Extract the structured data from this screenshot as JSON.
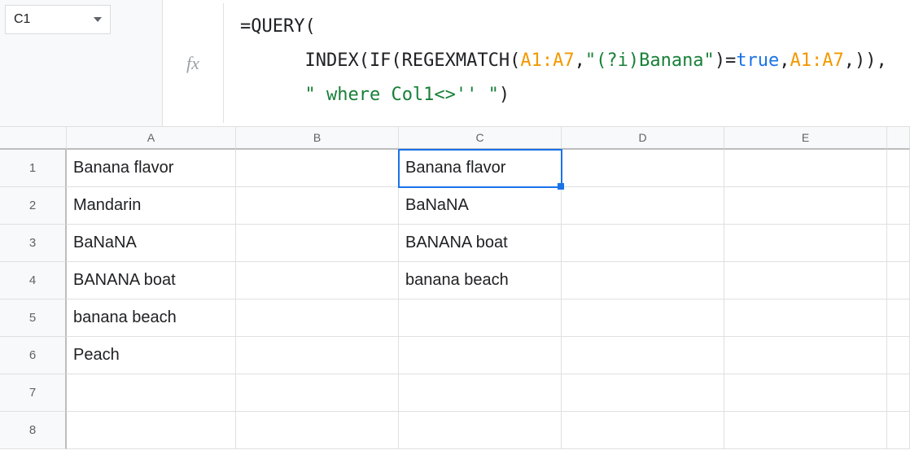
{
  "nameBox": {
    "value": "C1"
  },
  "fx": {
    "label": "fx"
  },
  "formula": {
    "tokens": [
      [
        {
          "t": "=QUERY(",
          "c": "tok-func"
        }
      ],
      [
        {
          "t": "      INDEX(IF(REGEXMATCH(",
          "c": "tok-func"
        },
        {
          "t": "A1:A7",
          "c": "tok-range"
        },
        {
          "t": ",",
          "c": "tok-func"
        },
        {
          "t": "\"(?i)Banana\"",
          "c": "tok-string"
        },
        {
          "t": ")=",
          "c": "tok-func"
        },
        {
          "t": "true",
          "c": "tok-bool"
        },
        {
          "t": ",",
          "c": "tok-func"
        },
        {
          "t": "A1:A7",
          "c": "tok-range"
        },
        {
          "t": ",)),",
          "c": "tok-func"
        }
      ],
      [
        {
          "t": "      ",
          "c": "tok-func"
        },
        {
          "t": "\" where Col1<>'' \"",
          "c": "tok-string"
        },
        {
          "t": ")",
          "c": "tok-func"
        }
      ]
    ]
  },
  "columns": [
    "A",
    "B",
    "C",
    "D",
    "E",
    ""
  ],
  "rows": [
    {
      "n": "1",
      "A": "Banana flavor",
      "B": "",
      "C": "Banana flavor",
      "D": "",
      "E": ""
    },
    {
      "n": "2",
      "A": "Mandarin",
      "B": "",
      "C": "BaNaNA",
      "D": "",
      "E": ""
    },
    {
      "n": "3",
      "A": "BaNaNA",
      "B": "",
      "C": "BANANA boat",
      "D": "",
      "E": ""
    },
    {
      "n": "4",
      "A": "BANANA boat",
      "B": "",
      "C": "banana beach",
      "D": "",
      "E": ""
    },
    {
      "n": "5",
      "A": "banana beach",
      "B": "",
      "C": "",
      "D": "",
      "E": ""
    },
    {
      "n": "6",
      "A": "Peach",
      "B": "",
      "C": "",
      "D": "",
      "E": ""
    },
    {
      "n": "7",
      "A": "",
      "B": "",
      "C": "",
      "D": "",
      "E": ""
    },
    {
      "n": "8",
      "A": "",
      "B": "",
      "C": "",
      "D": "",
      "E": ""
    }
  ],
  "selectedCell": "C1"
}
